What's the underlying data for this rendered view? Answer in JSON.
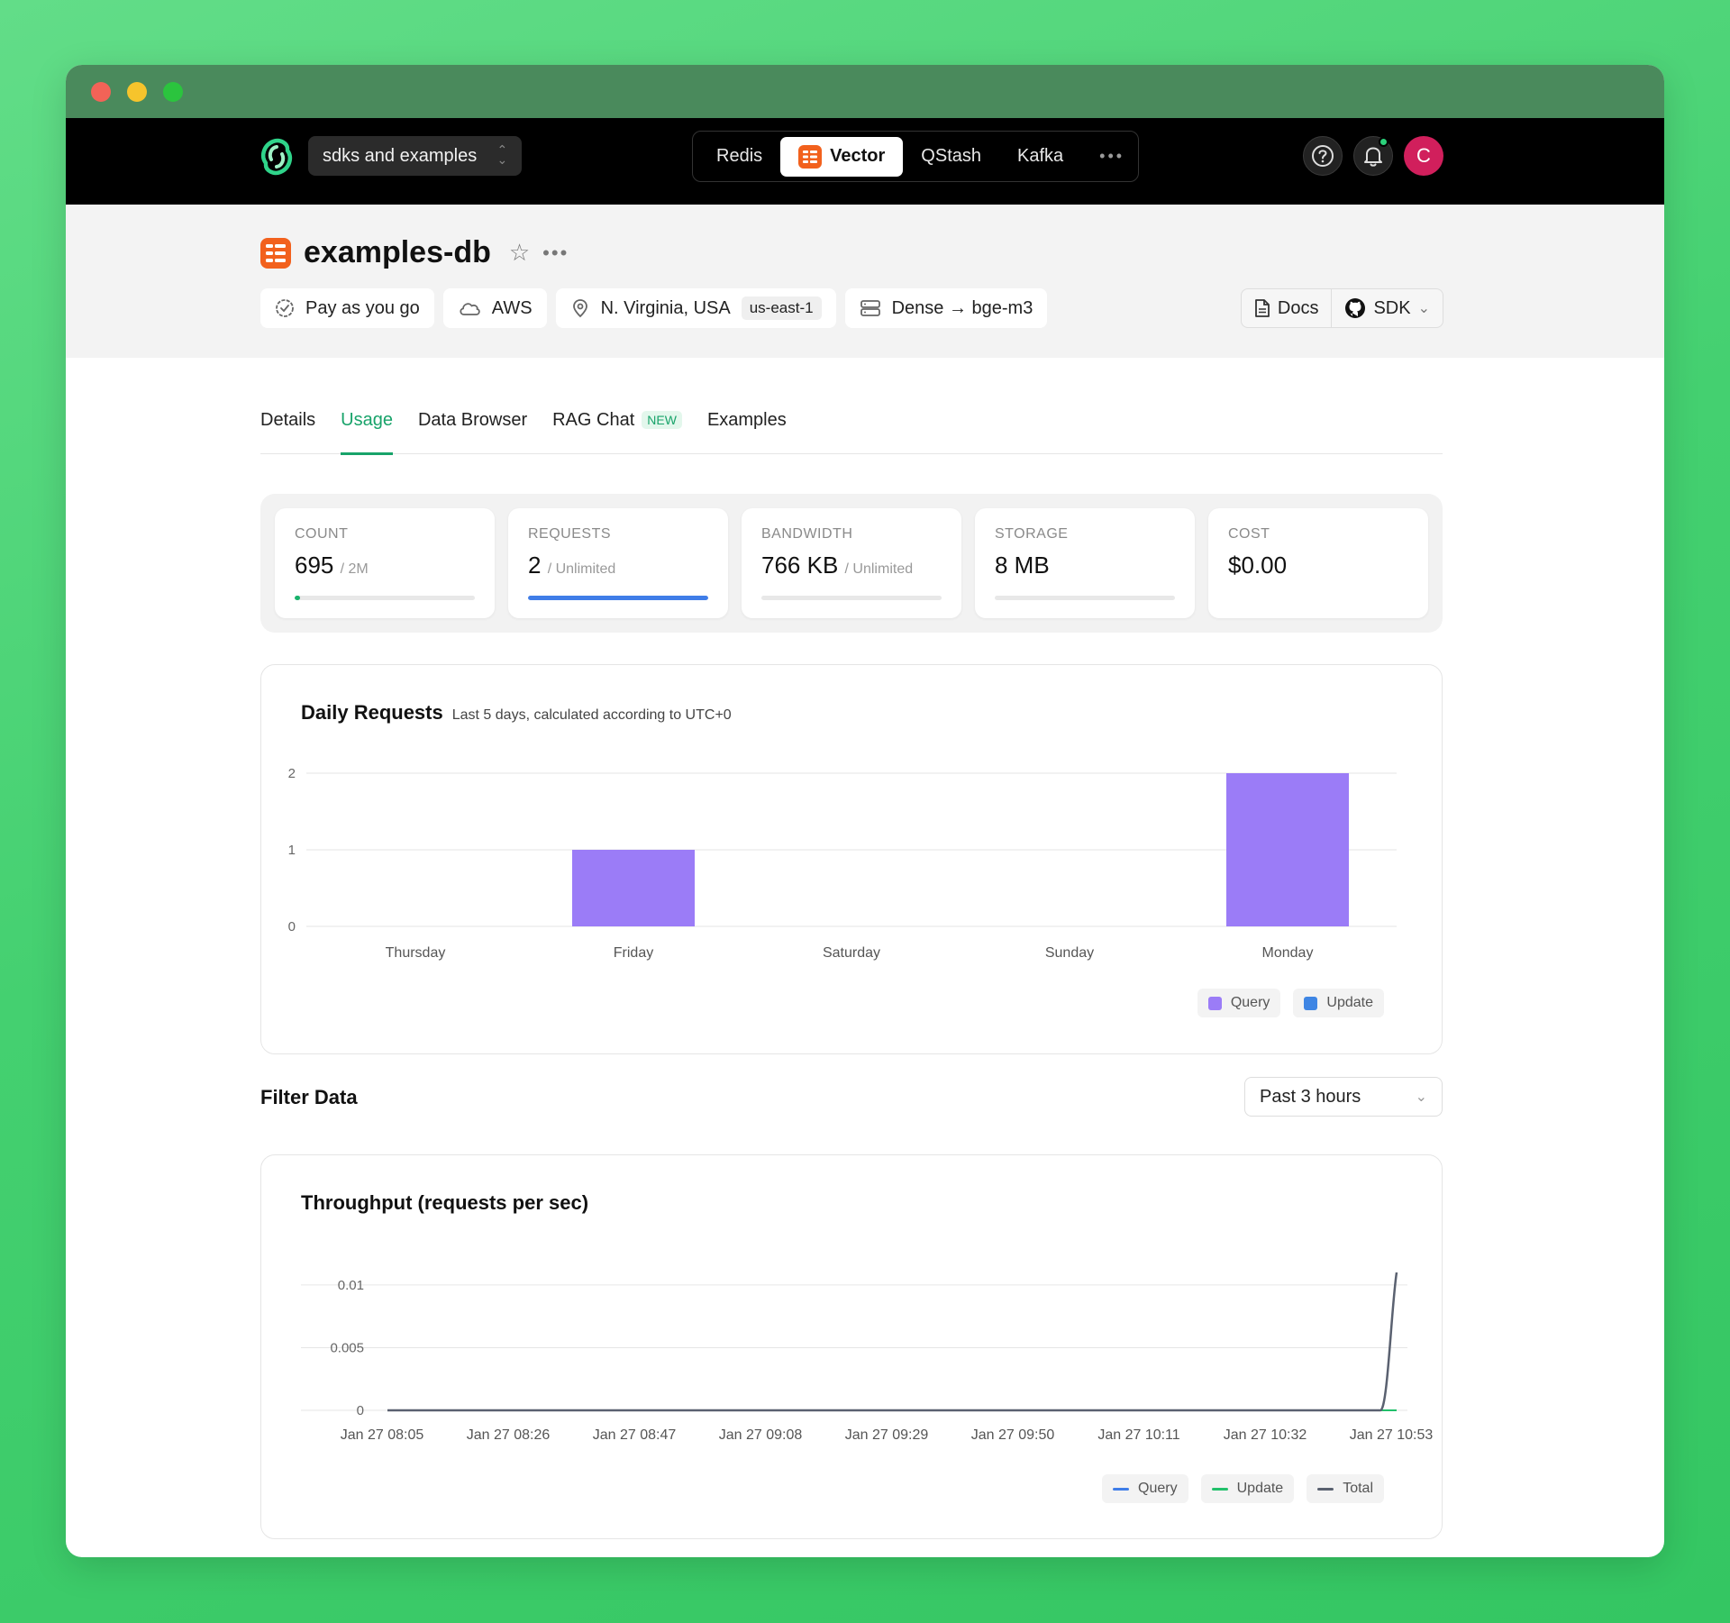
{
  "nav": {
    "project": "sdks and examples",
    "tabs": [
      "Redis",
      "Vector",
      "QStash",
      "Kafka"
    ],
    "active_tab": "Vector",
    "avatar_initial": "C"
  },
  "database": {
    "name": "examples-db",
    "plan": "Pay as you go",
    "provider": "AWS",
    "region": "N. Virginia, USA",
    "region_code": "us-east-1",
    "index_type": "Dense → bge-m3",
    "docs_label": "Docs",
    "sdk_label": "SDK"
  },
  "tabs": [
    "Details",
    "Usage",
    "Data Browser",
    "RAG Chat",
    "Examples"
  ],
  "active_tab": "Usage",
  "new_badge": "NEW",
  "stats": [
    {
      "label": "COUNT",
      "value": "695",
      "limit": "/ 2M",
      "progress": 0.003,
      "color": "#18b26b"
    },
    {
      "label": "REQUESTS",
      "value": "2",
      "limit": "/ Unlimited",
      "progress": 1.0,
      "color": "#3f7de8"
    },
    {
      "label": "BANDWIDTH",
      "value": "766 KB",
      "limit": "/ Unlimited",
      "progress": 0.0,
      "color": "#3f7de8"
    },
    {
      "label": "STORAGE",
      "value": "8 MB",
      "limit": "",
      "progress": 0.0,
      "color": "#3f7de8"
    },
    {
      "label": "COST",
      "value": "$0.00",
      "limit": "",
      "progress": null,
      "color": ""
    }
  ],
  "daily": {
    "title": "Daily Requests",
    "subtitle": "Last 5 days, calculated according to UTC+0"
  },
  "filter": {
    "title": "Filter Data",
    "range": "Past 3 hours"
  },
  "throughput": {
    "title": "Throughput (requests per sec)"
  },
  "colors": {
    "query": "#9b7cf7",
    "update": "#3f86e4",
    "line_query": "#3f7de8",
    "line_update": "#22c06b",
    "line_total": "#5a6170",
    "accent": "#18a36a"
  },
  "chart_data": [
    {
      "type": "bar",
      "title": "Daily Requests",
      "categories": [
        "Thursday",
        "Friday",
        "Saturday",
        "Sunday",
        "Monday"
      ],
      "series": [
        {
          "name": "Query",
          "values": [
            0,
            1,
            0,
            0,
            2
          ]
        },
        {
          "name": "Update",
          "values": [
            0,
            0,
            0,
            0,
            0
          ]
        }
      ],
      "yticks": [
        0,
        1,
        2
      ],
      "ylim": [
        0,
        2
      ],
      "legend": "bottom-right",
      "grid": true
    },
    {
      "type": "line",
      "title": "Throughput (requests per sec)",
      "x": [
        "Jan 27 08:05",
        "Jan 27 08:26",
        "Jan 27 08:47",
        "Jan 27 09:08",
        "Jan 27 09:29",
        "Jan 27 09:50",
        "Jan 27 10:11",
        "Jan 27 10:32",
        "Jan 27 10:53"
      ],
      "series": [
        {
          "name": "Query",
          "values": [
            0,
            0,
            0,
            0,
            0,
            0,
            0,
            0,
            0
          ]
        },
        {
          "name": "Update",
          "values": [
            0,
            0,
            0,
            0,
            0,
            0,
            0,
            0,
            0
          ]
        },
        {
          "name": "Total",
          "values": [
            0,
            0,
            0,
            0,
            0,
            0,
            0,
            0,
            0.011
          ]
        }
      ],
      "yticks": [
        "0",
        "0.005",
        "0.01"
      ],
      "ylim": [
        0,
        0.011
      ],
      "legend": "bottom-right",
      "grid": true
    }
  ]
}
